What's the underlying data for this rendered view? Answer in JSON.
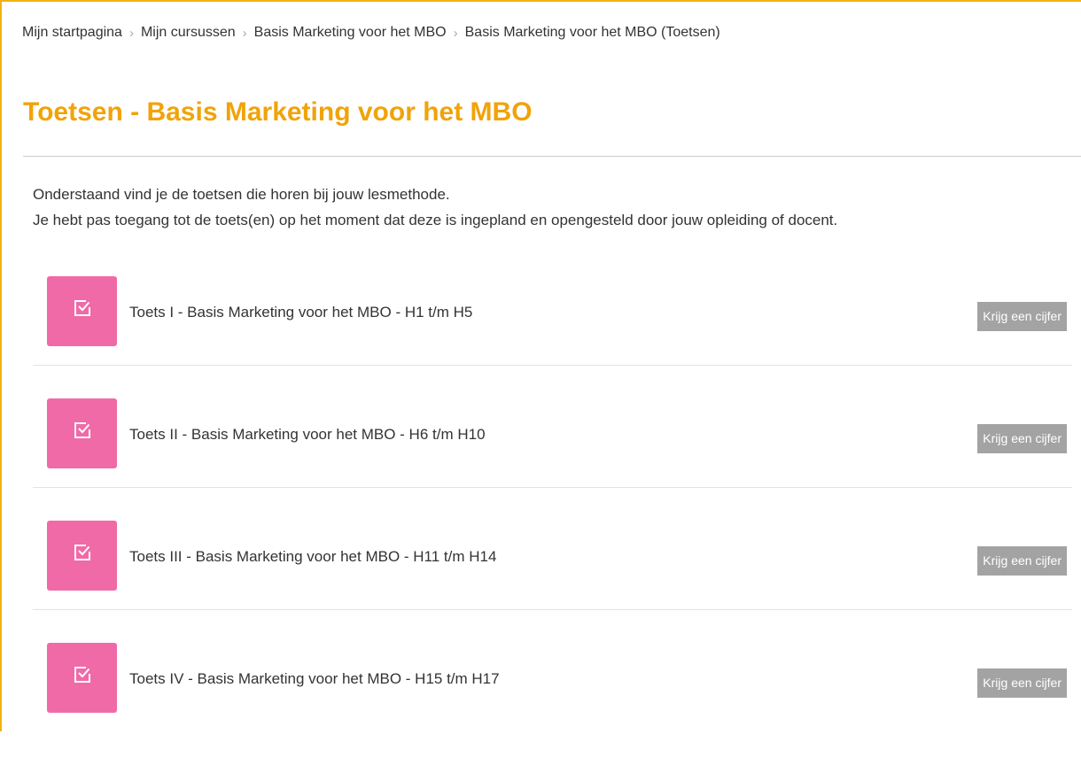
{
  "breadcrumb": [
    "Mijn startpagina",
    "Mijn cursussen",
    "Basis Marketing voor het MBO",
    "Basis Marketing voor het MBO (Toetsen)"
  ],
  "breadcrumb_separator": "›",
  "page_title": "Toetsen - Basis Marketing voor het MBO",
  "intro": {
    "line1": "Onderstaand vind je de toetsen die horen bij jouw lesmethode.",
    "line2": "Je hebt pas toegang tot de toets(en) op het moment dat deze is ingepland en opengesteld door jouw opleiding of docent."
  },
  "tests": [
    {
      "name": "Toets I - Basis Marketing voor het MBO - H1 t/m H5",
      "button": "Krijg een cijfer"
    },
    {
      "name": "Toets II - Basis Marketing voor het MBO - H6 t/m H10",
      "button": "Krijg een cijfer"
    },
    {
      "name": "Toets III - Basis Marketing voor het MBO - H11 t/m H14",
      "button": "Krijg een cijfer"
    },
    {
      "name": "Toets IV - Basis Marketing voor het MBO - H15 t/m H17",
      "button": "Krijg een cijfer"
    }
  ],
  "icons": {
    "test_tile": "checkbox-check-icon"
  },
  "colors": {
    "accent": "#f0a30a",
    "frame": "#f0b410",
    "tile": "#f06aa8",
    "button": "#a3a3a3"
  }
}
